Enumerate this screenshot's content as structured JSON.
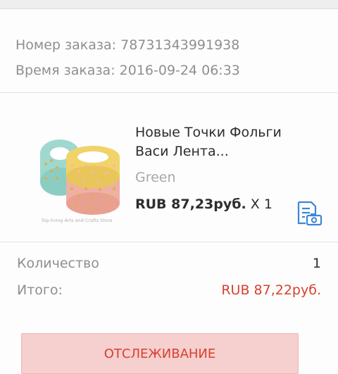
{
  "order": {
    "number_label": "Номер заказа:",
    "number_value": "78731343991938",
    "time_label": "Время заказа:",
    "time_value": "2016-09-24 06:33"
  },
  "product": {
    "title_line1": "Новые Точки Фольги",
    "title_line2": "Васи Лента...",
    "variant": "Green",
    "price": "RUB 87,23руб.",
    "quantity": "X 1",
    "image_watermark": "Top-living Arts and Crafts Store",
    "review_icon": "review-photo-icon"
  },
  "summary": {
    "quantity_label": "Количество",
    "quantity_value": "1",
    "total_label": "Итого:",
    "total_value": "RUB 87,22руб."
  },
  "actions": {
    "track_label": "ОТСЛЕЖИВАНИЕ"
  },
  "colors": {
    "accent": "#d8402e",
    "button_bg": "#f6cfcf",
    "icon_blue": "#3b86d6"
  }
}
